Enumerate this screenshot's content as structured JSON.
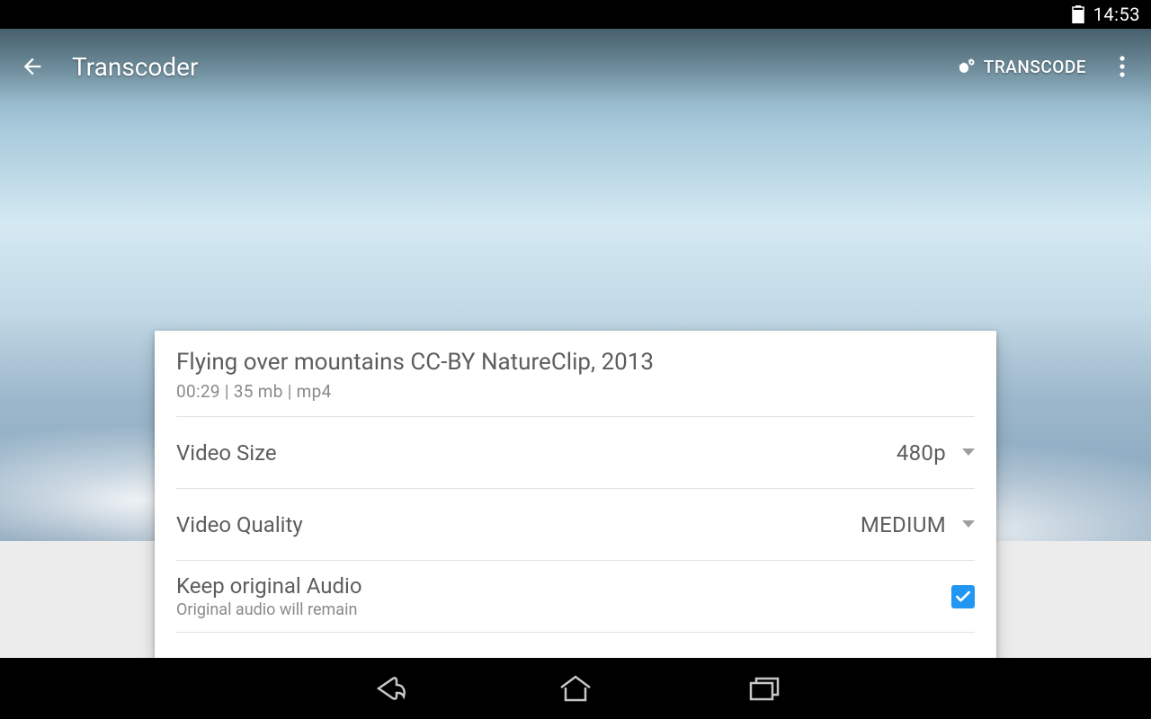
{
  "status": {
    "time": "14:53"
  },
  "appbar": {
    "title": "Transcoder",
    "action_label": "TRANSCODE"
  },
  "card": {
    "title": "Flying over mountains CC-BY NatureClip, 2013",
    "subtitle": "00:29 | 35 mb | mp4",
    "rows": {
      "size": {
        "label": "Video Size",
        "value": "480p"
      },
      "quality": {
        "label": "Video Quality",
        "value": "MEDIUM"
      },
      "audio": {
        "label": "Keep original Audio",
        "sub": "Original audio will remain",
        "checked": true
      }
    }
  }
}
